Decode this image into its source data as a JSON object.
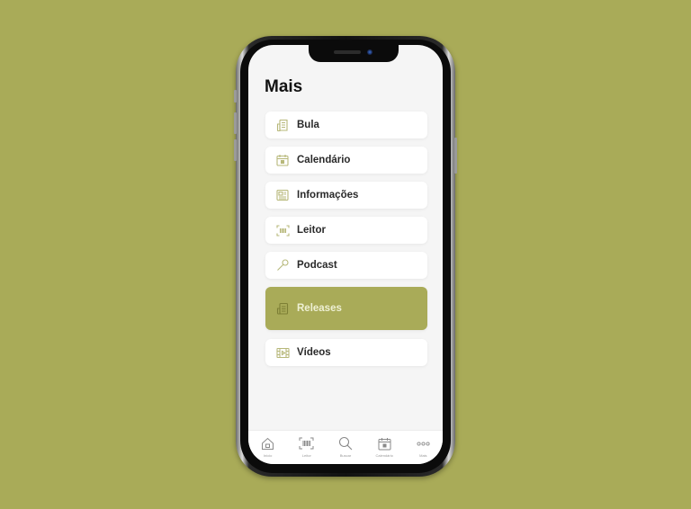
{
  "page": {
    "title": "Mais"
  },
  "colors": {
    "background": "#a9ab58",
    "accent": "#a9ab58",
    "icon": "#b7b87a",
    "screen": "#f5f5f5"
  },
  "menu": {
    "items": [
      {
        "label": "Bula",
        "icon": "document-icon",
        "active": false
      },
      {
        "label": "Calendário",
        "icon": "calendar-icon",
        "active": false
      },
      {
        "label": "Informações",
        "icon": "newspaper-icon",
        "active": false
      },
      {
        "label": "Leitor",
        "icon": "barcode-scan-icon",
        "active": false
      },
      {
        "label": "Podcast",
        "icon": "microphone-icon",
        "active": false
      },
      {
        "label": "Releases",
        "icon": "release-doc-icon",
        "active": true
      },
      {
        "label": "Vídeos",
        "icon": "film-icon",
        "active": false
      }
    ]
  },
  "tabbar": {
    "tabs": [
      {
        "label": "Início",
        "icon": "home-icon"
      },
      {
        "label": "Leitor",
        "icon": "barcode-scan-icon"
      },
      {
        "label": "Buscar",
        "icon": "search-icon"
      },
      {
        "label": "Calendário",
        "icon": "calendar-icon"
      },
      {
        "label": "Mais",
        "icon": "more-dots-icon"
      }
    ]
  }
}
